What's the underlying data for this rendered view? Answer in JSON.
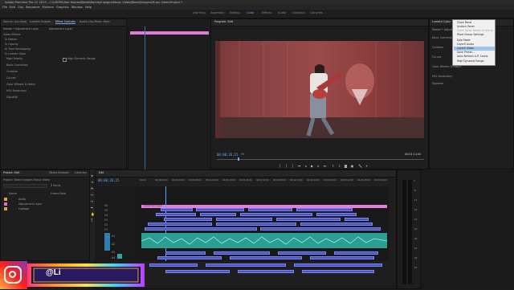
{
  "app": {
    "title": "Adobe Premiere Pro CC 2019 - C:\\USERS\\Abe Haines\\Bleed\\Barkle(Inaegirs\\Music Video\\Bleed\\Iniagirs\\Music Video\\Project *",
    "menu": [
      "File",
      "Edit",
      "Clip",
      "Sequence",
      "Markers",
      "Graphics",
      "Window",
      "Help"
    ]
  },
  "workspaces": {
    "items": [
      "Learning",
      "Assembly",
      "Editing",
      "Color",
      "Effects",
      "Audio",
      "Graphics",
      "Libraries"
    ],
    "active": "Color"
  },
  "effect_controls": {
    "tabs": [
      "Source: (no clips)",
      "Lumetri Scopes",
      "Effect Controls",
      "Audio Clip Mixer: Main"
    ],
    "active_tab": "Effect Controls",
    "subtitle": "Master * Adjustment Layer",
    "clip_name": "Adjustment Layer",
    "rows": [
      "Video Effects",
      "fx Motion",
      "fx Opacity",
      "fx Time Remapping",
      "fx Lumetri Color",
      "  High Fidelity",
      "  Basic Correction",
      "  Creative",
      "  Curves",
      "  Color Wheels & Match",
      "  HSL Secondary",
      "  Vignette"
    ],
    "checkbox_label": "High Dynamic Range"
  },
  "program": {
    "tab": "Program: Edit",
    "timecode_left": "00;00;26;15",
    "fit": "Fit",
    "timecode_right": "00;04;14;04",
    "controls": [
      "mark-in",
      "mark-out",
      "go-to-in",
      "step-back",
      "play",
      "step-forward",
      "go-to-out",
      "lift",
      "extract",
      "export-frame",
      "compare",
      "settings",
      "add"
    ]
  },
  "lumetri": {
    "tab": "Lumetri Color",
    "rows": [
      "Master * Adjustment Layer",
      "Basic Correction",
      "Creative",
      "Curves",
      "Color Wheels & Match",
      "HSL Secondary",
      "Vignette"
    ]
  },
  "context_menu": {
    "items": [
      "Close Panel",
      "Undock Panel",
      "Close Other Panels in Group",
      "Panel Group Settings",
      "Solo Mode",
      "Layer5 Audio",
      "Layer5 Video",
      "Save Preset...",
      "Auto-Refresh LUT Cache",
      "High Dynamic Range"
    ],
    "highlighted_index": 6,
    "disabled_index": 2
  },
  "project": {
    "tabs": [
      "Project: Edit",
      "Media Browser",
      "Libraries"
    ],
    "path": "Project: Bleed Inaegirs Music Video",
    "search_placeholder": "",
    "item_count": "3 Items",
    "columns": [
      "Name",
      "Frame Rate"
    ],
    "items": [
      "Audio",
      "Adjustment Layer",
      "Footage"
    ]
  },
  "timeline": {
    "tab": "Edit",
    "timecode": "00;00;26;15",
    "ruler": [
      "00;00",
      "00;00;16;00",
      "00;00;32;00",
      "00;00;48;00",
      "00;01;04;00",
      "00;01;20;00",
      "00;01;36;00",
      "00;01;52;00",
      "00;02;08;00",
      "00;02;24;00",
      "00;02;40;00",
      "00;02;56;00",
      "00;03;12;00",
      "00;03;28;00",
      "00;03;44;00"
    ],
    "video_tracks": [
      "V6",
      "V5",
      "V4",
      "V3",
      "V2",
      "V1"
    ],
    "audio_tracks": [
      "A1",
      "A2",
      "A3",
      "A4"
    ],
    "adjustment_clip": "Adjustment Layer",
    "audio_meter_labels": [
      "0",
      "-6",
      "-12",
      "-18",
      "-24",
      "-30",
      "-36",
      "-42",
      "-48",
      "-54"
    ]
  },
  "overlay": {
    "handle": "@Li",
    "icon": "instagram-icon"
  }
}
